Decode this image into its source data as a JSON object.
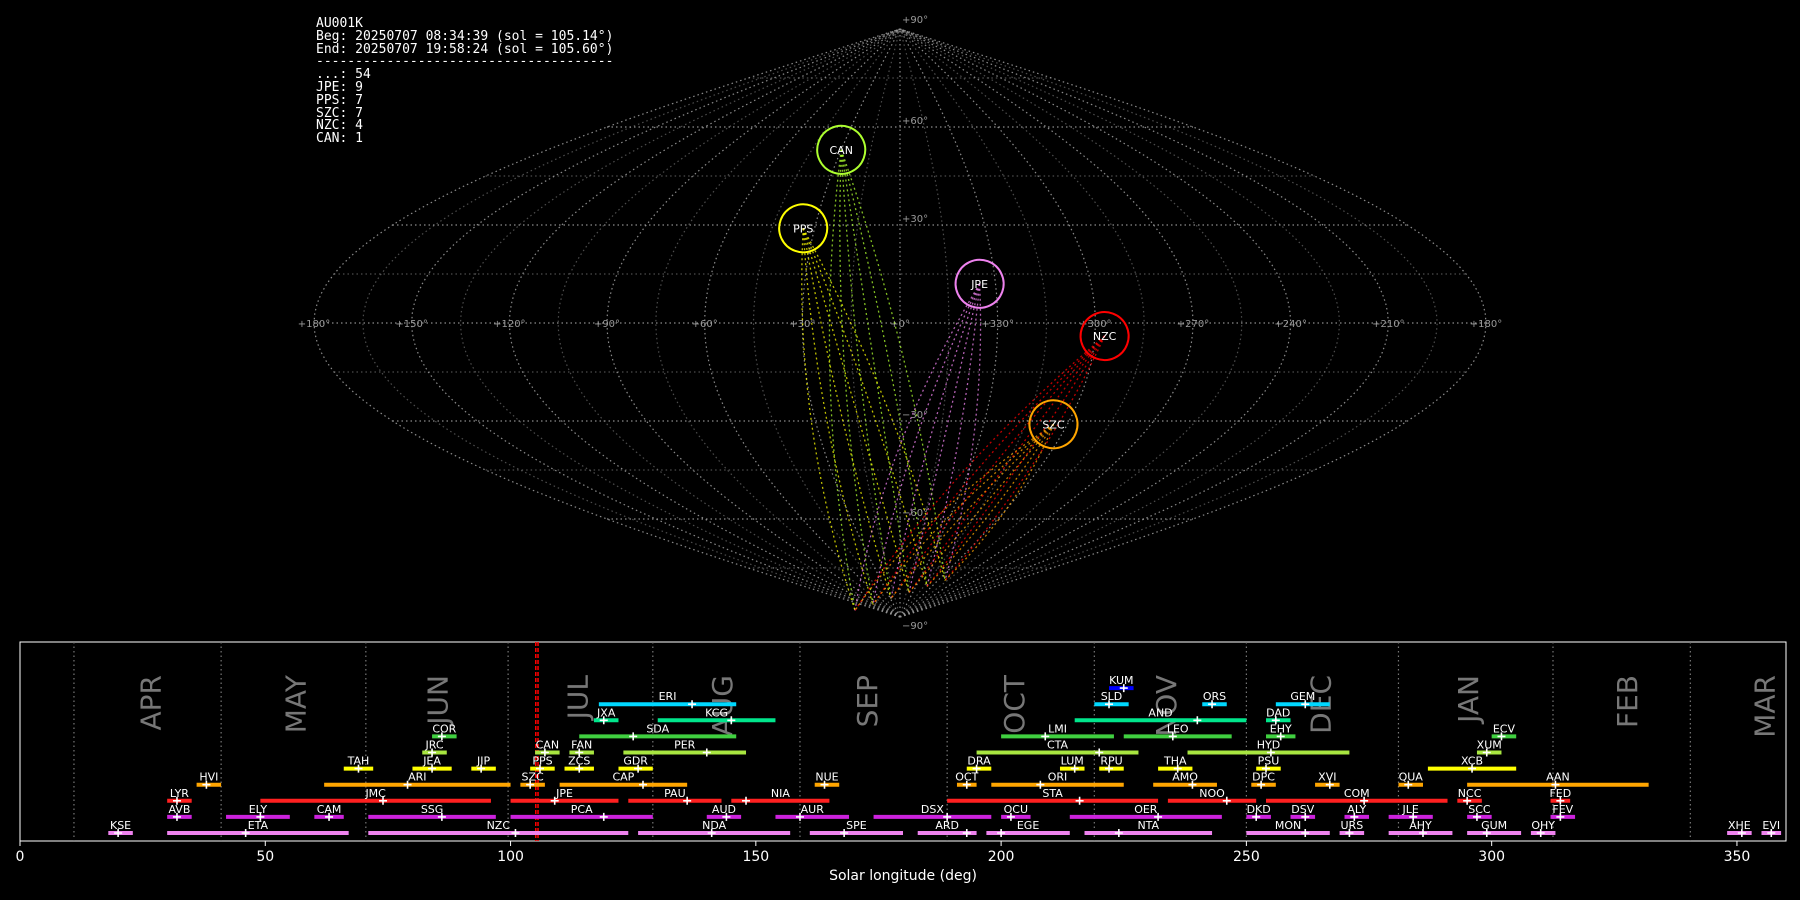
{
  "info": {
    "station": "AU001K",
    "begin": "Beg: 20250707 08:34:39 (sol = 105.14°)",
    "end": "End: 20250707 19:58:24 (sol = 105.60°)",
    "separator": "--------------------------------------",
    "counts": [
      {
        "code": "...",
        "n": 54
      },
      {
        "code": "JPE",
        "n": 9
      },
      {
        "code": "PPS",
        "n": 7
      },
      {
        "code": "SZC",
        "n": 7
      },
      {
        "code": "NZC",
        "n": 4
      },
      {
        "code": "CAN",
        "n": 1
      }
    ]
  },
  "chart_data": [
    {
      "type": "scatter",
      "projection": "sinusoidal",
      "lon_ticks": [
        "+180°",
        "+150°",
        "+120°",
        "+90°",
        "+60°",
        "+30°",
        "+0°",
        "+330°",
        "+300°",
        "+270°",
        "+240°",
        "+210°",
        "+180°"
      ],
      "lat_ticks": [
        "+90°",
        "+60°",
        "+30°",
        "−30°",
        "−60°",
        "−90°"
      ],
      "radiants": [
        {
          "code": "CAN",
          "lon": 30,
          "lat": 53,
          "color": "#adff2f"
        },
        {
          "code": "PPS",
          "lon": 34,
          "lat": 29,
          "color": "#ffff00"
        },
        {
          "code": "JPE",
          "lon": -25,
          "lat": 12,
          "color": "#ee82ee"
        },
        {
          "code": "NZC",
          "lon": -63,
          "lat": -4,
          "color": "#ff0000"
        },
        {
          "code": "SZC",
          "lon": -55,
          "lat": -31,
          "color": "#ffa500"
        }
      ]
    },
    {
      "type": "bar",
      "xlabel": "Solar longitude (deg)",
      "xlim": [
        0,
        360
      ],
      "x_ticks": [
        0,
        50,
        100,
        150,
        200,
        250,
        300,
        350
      ],
      "current_sol": [
        105.14,
        105.6
      ],
      "months": [
        {
          "name": "APR",
          "pos": 25
        },
        {
          "name": "MAY",
          "pos": 54.5
        },
        {
          "name": "JUN",
          "pos": 83.5
        },
        {
          "name": "JUL",
          "pos": 112
        },
        {
          "name": "AUG",
          "pos": 141.5
        },
        {
          "name": "SEP",
          "pos": 171
        },
        {
          "name": "OCT",
          "pos": 201
        },
        {
          "name": "NOV",
          "pos": 232
        },
        {
          "name": "DEC",
          "pos": 263.5
        },
        {
          "name": "JAN",
          "pos": 293.5
        },
        {
          "name": "FEB",
          "pos": 326
        },
        {
          "name": "MAR",
          "pos": 354
        }
      ],
      "month_lines": [
        11,
        41,
        70.5,
        99.5,
        129,
        159,
        189,
        219,
        250,
        281,
        312.5,
        340.5
      ],
      "showers": [
        {
          "code": "KUM",
          "start": 222,
          "end": 227,
          "peak": 225,
          "row": 9,
          "color": "#0000ff"
        },
        {
          "code": "ERI",
          "start": 118,
          "end": 146,
          "peak": 137,
          "row": 8,
          "color": "#00d8ff"
        },
        {
          "code": "SLD",
          "start": 219,
          "end": 226,
          "peak": 222,
          "row": 8,
          "color": "#00d8ff"
        },
        {
          "code": "ORS",
          "start": 241,
          "end": 246,
          "peak": 243,
          "row": 8,
          "color": "#00d8ff"
        },
        {
          "code": "GEM",
          "start": 256,
          "end": 267,
          "peak": 262,
          "row": 8,
          "color": "#00d8ff"
        },
        {
          "code": "JXA",
          "start": 117,
          "end": 122,
          "peak": 119,
          "row": 7,
          "color": "#00e68c"
        },
        {
          "code": "KCG",
          "start": 130,
          "end": 154,
          "peak": 145,
          "row": 7,
          "color": "#00e68c"
        },
        {
          "code": "AND",
          "start": 215,
          "end": 250,
          "peak": 240,
          "row": 7,
          "color": "#00e68c"
        },
        {
          "code": "DAD",
          "start": 254,
          "end": 259,
          "peak": 256,
          "row": 7,
          "color": "#00e68c"
        },
        {
          "code": "COR",
          "start": 84,
          "end": 89,
          "peak": 86,
          "row": 6,
          "color": "#40d040"
        },
        {
          "code": "SDA",
          "start": 114,
          "end": 146,
          "peak": 125,
          "row": 6,
          "color": "#40d040"
        },
        {
          "code": "LMI",
          "start": 200,
          "end": 223,
          "peak": 209,
          "row": 6,
          "color": "#40d040"
        },
        {
          "code": "LEO",
          "start": 225,
          "end": 247,
          "peak": 235,
          "row": 6,
          "color": "#40d040"
        },
        {
          "code": "EHY",
          "start": 254,
          "end": 260,
          "peak": 257,
          "row": 6,
          "color": "#40d040"
        },
        {
          "code": "ECV",
          "start": 300,
          "end": 305,
          "peak": 302,
          "row": 6,
          "color": "#40d040"
        },
        {
          "code": "JRC",
          "start": 82,
          "end": 87,
          "peak": 84,
          "row": 5,
          "color": "#a8e640"
        },
        {
          "code": "CAN",
          "start": 105,
          "end": 110,
          "peak": 107,
          "row": 5,
          "color": "#a8e640"
        },
        {
          "code": "FAN",
          "start": 112,
          "end": 117,
          "peak": 114,
          "row": 5,
          "color": "#a8e640"
        },
        {
          "code": "PER",
          "start": 123,
          "end": 148,
          "peak": 140,
          "row": 5,
          "color": "#a8e640"
        },
        {
          "code": "CTA",
          "start": 195,
          "end": 228,
          "peak": 220,
          "row": 5,
          "color": "#a8e640"
        },
        {
          "code": "HYD",
          "start": 238,
          "end": 271,
          "peak": 255,
          "row": 5,
          "color": "#a8e640"
        },
        {
          "code": "XUM",
          "start": 297,
          "end": 302,
          "peak": 299,
          "row": 5,
          "color": "#a8e640"
        },
        {
          "code": "TAH",
          "start": 66,
          "end": 72,
          "peak": 69,
          "row": 4,
          "color": "#ffff00"
        },
        {
          "code": "JEA",
          "start": 80,
          "end": 88,
          "peak": 84,
          "row": 4,
          "color": "#ffff00"
        },
        {
          "code": "JIP",
          "start": 92,
          "end": 97,
          "peak": 94,
          "row": 4,
          "color": "#ffff00"
        },
        {
          "code": "PPS",
          "start": 104,
          "end": 109,
          "peak": 106,
          "row": 4,
          "color": "#ffff00"
        },
        {
          "code": "ZCS",
          "start": 111,
          "end": 117,
          "peak": 114,
          "row": 4,
          "color": "#ffff00"
        },
        {
          "code": "GDR",
          "start": 122,
          "end": 129,
          "peak": 126,
          "row": 4,
          "color": "#ffff00"
        },
        {
          "code": "DRA",
          "start": 193,
          "end": 198,
          "peak": 195,
          "row": 4,
          "color": "#ffff00"
        },
        {
          "code": "LUM",
          "start": 212,
          "end": 217,
          "peak": 215,
          "row": 4,
          "color": "#ffff00"
        },
        {
          "code": "RPU",
          "start": 220,
          "end": 225,
          "peak": 222,
          "row": 4,
          "color": "#ffff00"
        },
        {
          "code": "THA",
          "start": 232,
          "end": 239,
          "peak": 236,
          "row": 4,
          "color": "#ffff00"
        },
        {
          "code": "PSU",
          "start": 252,
          "end": 257,
          "peak": 254,
          "row": 4,
          "color": "#ffff00"
        },
        {
          "code": "XCB",
          "start": 287,
          "end": 305,
          "peak": 296,
          "row": 4,
          "color": "#ffff00"
        },
        {
          "code": "HVI",
          "start": 36,
          "end": 41,
          "peak": 38,
          "row": 3,
          "color": "#ffa500"
        },
        {
          "code": "ARI",
          "start": 62,
          "end": 100,
          "peak": 79,
          "row": 3,
          "color": "#ffa500"
        },
        {
          "code": "SZC",
          "start": 102,
          "end": 107,
          "peak": 104,
          "row": 3,
          "color": "#ffa500"
        },
        {
          "code": "CAP",
          "start": 110,
          "end": 136,
          "peak": 127,
          "row": 3,
          "color": "#ffa500"
        },
        {
          "code": "NUE",
          "start": 162,
          "end": 167,
          "peak": 164,
          "row": 3,
          "color": "#ffa500"
        },
        {
          "code": "OCT",
          "start": 191,
          "end": 195,
          "peak": 193,
          "row": 3,
          "color": "#ffa500"
        },
        {
          "code": "ORI",
          "start": 198,
          "end": 225,
          "peak": 208,
          "row": 3,
          "color": "#ffa500"
        },
        {
          "code": "AMO",
          "start": 231,
          "end": 244,
          "peak": 239,
          "row": 3,
          "color": "#ffa500"
        },
        {
          "code": "DPC",
          "start": 251,
          "end": 256,
          "peak": 253,
          "row": 3,
          "color": "#ffa500"
        },
        {
          "code": "XVI",
          "start": 264,
          "end": 269,
          "peak": 267,
          "row": 3,
          "color": "#ffa500"
        },
        {
          "code": "QUA",
          "start": 281,
          "end": 286,
          "peak": 283,
          "row": 3,
          "color": "#ffa500"
        },
        {
          "code": "AAN",
          "start": 295,
          "end": 332,
          "peak": 313,
          "row": 3,
          "color": "#ffa500"
        },
        {
          "code": "LYR",
          "start": 30,
          "end": 35,
          "peak": 32,
          "row": 2,
          "color": "#ff2020"
        },
        {
          "code": "JMC",
          "start": 49,
          "end": 96,
          "peak": 74,
          "row": 2,
          "color": "#ff2020"
        },
        {
          "code": "JPE",
          "start": 100,
          "end": 122,
          "peak": 109,
          "row": 2,
          "color": "#ff2020"
        },
        {
          "code": "PAU",
          "start": 124,
          "end": 143,
          "peak": 136,
          "row": 2,
          "color": "#ff2020"
        },
        {
          "code": "NIA",
          "start": 145,
          "end": 165,
          "peak": 148,
          "row": 2,
          "color": "#ff2020"
        },
        {
          "code": "STA",
          "start": 189,
          "end": 232,
          "peak": 216,
          "row": 2,
          "color": "#ff2020"
        },
        {
          "code": "NOO",
          "start": 234,
          "end": 252,
          "peak": 246,
          "row": 2,
          "color": "#ff2020"
        },
        {
          "code": "COM",
          "start": 254,
          "end": 291,
          "peak": 274,
          "row": 2,
          "color": "#ff2020"
        },
        {
          "code": "NCC",
          "start": 293,
          "end": 298,
          "peak": 295,
          "row": 2,
          "color": "#ff2020"
        },
        {
          "code": "FED",
          "start": 312,
          "end": 316,
          "peak": 314,
          "row": 2,
          "color": "#ff2020"
        },
        {
          "code": "AVB",
          "start": 30,
          "end": 35,
          "peak": 32,
          "row": 1,
          "color": "#cc22dd"
        },
        {
          "code": "ELY",
          "start": 42,
          "end": 55,
          "peak": 49,
          "row": 1,
          "color": "#cc22dd"
        },
        {
          "code": "CAM",
          "start": 60,
          "end": 66,
          "peak": 63,
          "row": 1,
          "color": "#cc22dd"
        },
        {
          "code": "SSG",
          "start": 71,
          "end": 97,
          "peak": 86,
          "row": 1,
          "color": "#cc22dd"
        },
        {
          "code": "PCA",
          "start": 100,
          "end": 129,
          "peak": 119,
          "row": 1,
          "color": "#cc22dd"
        },
        {
          "code": "AUD",
          "start": 140,
          "end": 147,
          "peak": 144,
          "row": 1,
          "color": "#cc22dd"
        },
        {
          "code": "AUR",
          "start": 154,
          "end": 169,
          "peak": 159,
          "row": 1,
          "color": "#cc22dd"
        },
        {
          "code": "DSX",
          "start": 174,
          "end": 198,
          "peak": 189,
          "row": 1,
          "color": "#cc22dd"
        },
        {
          "code": "OCU",
          "start": 200,
          "end": 206,
          "peak": 202,
          "row": 1,
          "color": "#cc22dd"
        },
        {
          "code": "OER",
          "start": 214,
          "end": 245,
          "peak": 232,
          "row": 1,
          "color": "#cc22dd"
        },
        {
          "code": "DKD",
          "start": 250,
          "end": 255,
          "peak": 252,
          "row": 1,
          "color": "#cc22dd"
        },
        {
          "code": "DSV",
          "start": 259,
          "end": 264,
          "peak": 262,
          "row": 1,
          "color": "#cc22dd"
        },
        {
          "code": "ALY",
          "start": 270,
          "end": 275,
          "peak": 272,
          "row": 1,
          "color": "#cc22dd"
        },
        {
          "code": "JLE",
          "start": 279,
          "end": 288,
          "peak": 284,
          "row": 1,
          "color": "#cc22dd"
        },
        {
          "code": "SCC",
          "start": 295,
          "end": 300,
          "peak": 297,
          "row": 1,
          "color": "#cc22dd"
        },
        {
          "code": "FEV",
          "start": 312,
          "end": 317,
          "peak": 314,
          "row": 1,
          "color": "#cc22dd"
        },
        {
          "code": "KSE",
          "start": 18,
          "end": 23,
          "peak": 20,
          "row": 0,
          "color": "#ee82ee"
        },
        {
          "code": "ETA",
          "start": 30,
          "end": 67,
          "peak": 46,
          "row": 0,
          "color": "#ee82ee"
        },
        {
          "code": "NZC",
          "start": 71,
          "end": 124,
          "peak": 101,
          "row": 0,
          "color": "#ee82ee"
        },
        {
          "code": "NDA",
          "start": 126,
          "end": 157,
          "peak": 141,
          "row": 0,
          "color": "#ee82ee"
        },
        {
          "code": "SPE",
          "start": 161,
          "end": 180,
          "peak": 168,
          "row": 0,
          "color": "#ee82ee"
        },
        {
          "code": "ARD",
          "start": 183,
          "end": 195,
          "peak": 193,
          "row": 0,
          "color": "#ee82ee"
        },
        {
          "code": "EGE",
          "start": 197,
          "end": 214,
          "peak": 200,
          "row": 0,
          "color": "#ee82ee"
        },
        {
          "code": "NTA",
          "start": 217,
          "end": 243,
          "peak": 224,
          "row": 0,
          "color": "#ee82ee"
        },
        {
          "code": "MON",
          "start": 250,
          "end": 267,
          "peak": 262,
          "row": 0,
          "color": "#ee82ee"
        },
        {
          "code": "URS",
          "start": 269,
          "end": 274,
          "peak": 271,
          "row": 0,
          "color": "#ee82ee"
        },
        {
          "code": "AHY",
          "start": 279,
          "end": 292,
          "peak": 286,
          "row": 0,
          "color": "#ee82ee"
        },
        {
          "code": "GUM",
          "start": 295,
          "end": 306,
          "peak": 299,
          "row": 0,
          "color": "#ee82ee"
        },
        {
          "code": "OHY",
          "start": 308,
          "end": 313,
          "peak": 310,
          "row": 0,
          "color": "#ee82ee"
        },
        {
          "code": "XHE",
          "start": 348,
          "end": 353,
          "peak": 351,
          "row": 0,
          "color": "#ee82ee"
        },
        {
          "code": "EVI",
          "start": 355,
          "end": 359,
          "peak": 357,
          "row": 0,
          "color": "#ee82ee"
        }
      ]
    }
  ]
}
